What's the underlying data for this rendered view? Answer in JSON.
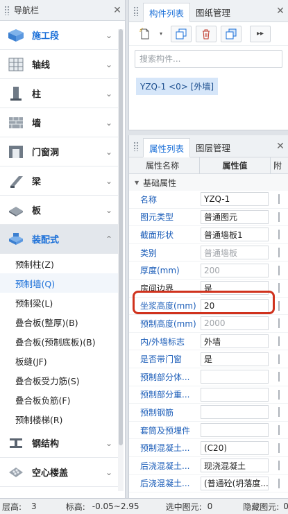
{
  "nav": {
    "title": "导航栏",
    "categories_top": [
      {
        "label": "施工段",
        "icon": "construction-stage-icon"
      },
      {
        "label": "轴线",
        "icon": "grid-axis-icon"
      },
      {
        "label": "柱",
        "icon": "column-icon"
      },
      {
        "label": "墙",
        "icon": "wall-icon"
      },
      {
        "label": "门窗洞",
        "icon": "door-window-icon"
      },
      {
        "label": "梁",
        "icon": "beam-icon"
      },
      {
        "label": "板",
        "icon": "slab-icon"
      },
      {
        "label": "装配式",
        "icon": "prefab-icon"
      }
    ],
    "sub_items": [
      "预制柱(Z)",
      "预制墙(Q)",
      "预制梁(L)",
      "叠合板(整厚)(B)",
      "叠合板(预制底板)(B)",
      "板缝(JF)",
      "叠合板受力筋(S)",
      "叠合板负筋(F)",
      "预制楼梯(R)"
    ],
    "categories_bottom": [
      {
        "label": "钢结构",
        "icon": "steel-structure-icon"
      },
      {
        "label": "空心楼盖",
        "icon": "hollow-floor-icon"
      }
    ]
  },
  "component_panel": {
    "tabs": [
      "构件列表",
      "图纸管理"
    ],
    "search_placeholder": "搜索构件...",
    "item": "YZQ-1 <0> [外墙]"
  },
  "property_panel": {
    "tabs": [
      "属性列表",
      "图层管理"
    ],
    "columns": [
      "属性名称",
      "属性值",
      "附"
    ],
    "group": "基础属性",
    "rows": [
      {
        "name": "名称",
        "value": "YZQ-1",
        "link": true,
        "disabled": false
      },
      {
        "name": "图元类型",
        "value": "普通图元",
        "link": true,
        "disabled": false
      },
      {
        "name": "截面形状",
        "value": "普通墙板1",
        "link": true,
        "disabled": false
      },
      {
        "name": "类别",
        "value": "普通墙板",
        "link": true,
        "disabled": true
      },
      {
        "name": "厚度(mm)",
        "value": "200",
        "link": true,
        "disabled": true
      },
      {
        "name": "房间边界",
        "value": "是",
        "link": false,
        "disabled": false
      },
      {
        "name": "坐浆高度(mm)",
        "value": "20",
        "link": true,
        "disabled": false
      },
      {
        "name": "预制高度(mm)",
        "value": "2000",
        "link": true,
        "disabled": true
      },
      {
        "name": "内/外墙标志",
        "value": "外墙",
        "link": true,
        "disabled": false
      },
      {
        "name": "是否带门窗",
        "value": "是",
        "link": true,
        "disabled": false
      },
      {
        "name": "预制部分体...",
        "value": "",
        "link": true,
        "disabled": false
      },
      {
        "name": "预制部分重...",
        "value": "",
        "link": true,
        "disabled": false
      },
      {
        "name": "预制钢筋",
        "value": "",
        "link": true,
        "disabled": false
      },
      {
        "name": "套筒及预埋件",
        "value": "",
        "link": true,
        "disabled": false
      },
      {
        "name": "预制混凝土...",
        "value": "(C20)",
        "link": true,
        "disabled": false
      },
      {
        "name": "后浇混凝土...",
        "value": "现浇混凝土",
        "link": true,
        "disabled": false
      },
      {
        "name": "后浇混凝土...",
        "value": "(普通砼(坍落度...",
        "link": true,
        "disabled": false
      }
    ]
  },
  "status": {
    "floor_label": "层高:",
    "floor_value": "3",
    "elev_label": "标高:",
    "elev_value": "-0.05~2.95",
    "selected_label": "选中图元:",
    "selected_value": "0",
    "hidden_label": "隐藏图元:",
    "hidden_value": "0"
  },
  "colors": {
    "accent": "#1a6fd8",
    "highlight": "#d0321d"
  }
}
